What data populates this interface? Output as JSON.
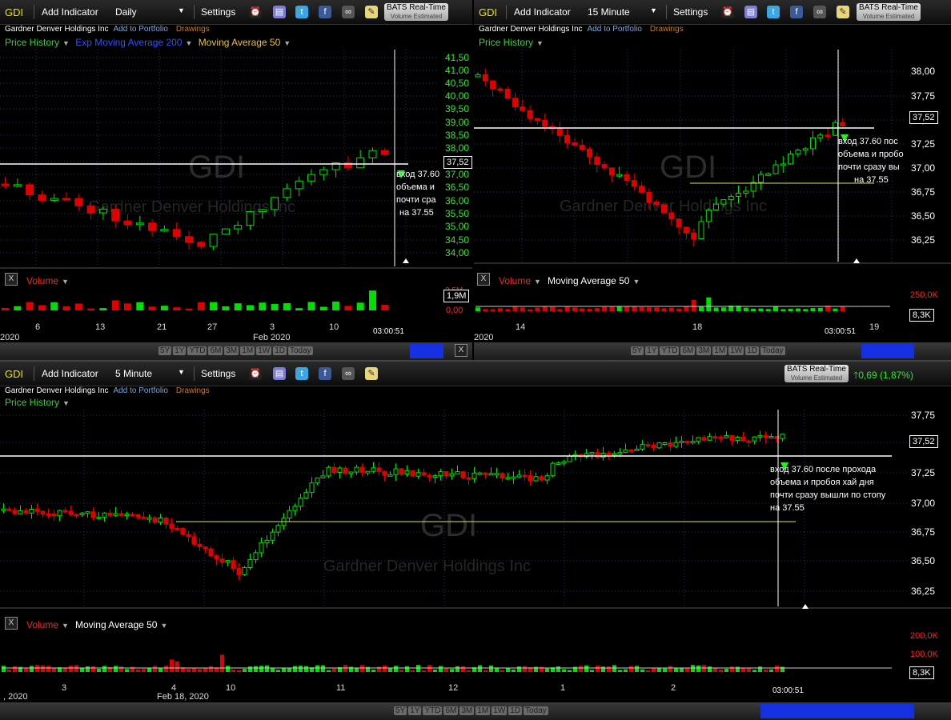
{
  "toolbar": {
    "add_indicator": "Add Indicator",
    "settings": "Settings",
    "bats": "BATS Real-Time",
    "volume_estimated": "Volume Estimated",
    "close": "X",
    "icons": [
      "alarm-clock-icon",
      "database-icon",
      "twitter-icon",
      "facebook-icon",
      "binoculars-icon",
      "notes-icon"
    ]
  },
  "company": {
    "symbol": "GDI",
    "name": "Gardner Denver Holdings Inc",
    "add_to_portfolio": "Add to Portfolio",
    "drawings": "Drawings"
  },
  "colors": {
    "up": "#00e000",
    "down": "#e00000",
    "price_line": "#ffffff",
    "support": "#e0e060",
    "ema": "#2f4fff",
    "ma": "#e6c23a"
  },
  "panel_daily": {
    "interval": "Daily",
    "price_history": "Price History",
    "ema_label": "Exp Moving Average 200",
    "ma_label": "Moving Average 50",
    "volume_label": "Volume",
    "watermark": "GDI",
    "price_tag": "37,52",
    "vol_tag": "1,9M",
    "vol_axis_top": "2,5M",
    "vol_axis_zero": "0,00",
    "price_ticks": [
      "41,50",
      "41,00",
      "40,50",
      "40,00",
      "39,50",
      "39,00",
      "38,50",
      "38,00",
      "37,50",
      "37,00",
      "36,50",
      "36,00",
      "35,50",
      "35,00",
      "34,50",
      "34,00"
    ],
    "date_ticks": [
      "6",
      "13",
      "21",
      "27",
      "3",
      "10"
    ],
    "date_start": "2020",
    "date_month": "Feb 2020",
    "time": "03:00:51",
    "annotation": [
      "вход 37.60",
      "объема и",
      "почти сра",
      "на 37.55"
    ],
    "ranges": [
      "5Y",
      "1Y",
      "YTD",
      "6M",
      "3M",
      "1M",
      "1W",
      "1D",
      "Today"
    ]
  },
  "panel_15m": {
    "interval": "15 Minute",
    "price_history": "Price History",
    "volume_label": "Volume",
    "ma_label": "Moving Average 50",
    "watermark": "GDI",
    "price_tag": "37,52",
    "vol_tag": "8,3K",
    "vol_axis_top": "250,0K",
    "price_ticks": [
      "38,00",
      "37,75",
      "37,50",
      "37,25",
      "37,00",
      "36,75",
      "36,50",
      "36,25"
    ],
    "date_ticks": [
      "14",
      "18",
      "19"
    ],
    "date_start": "2020",
    "time": "03:00:51",
    "annotation": [
      "вход 37.60 пос",
      "объема и пробо",
      "почти сразу вы",
      "на 37.55"
    ],
    "ranges": [
      "5Y",
      "1Y",
      "YTD",
      "6M",
      "3M",
      "1M",
      "1W",
      "1D",
      "Today"
    ]
  },
  "panel_5m": {
    "interval": "5 Minute",
    "price_history": "Price History",
    "volume_label": "Volume",
    "ma_label": "Moving Average 50",
    "watermark": "GDI",
    "change": "0,69 (1,87%)",
    "price_tag": "37,52",
    "vol_tag": "8,3K",
    "vol_axis": [
      "200,0K",
      "100,0K"
    ],
    "price_ticks": [
      "37,75",
      "37,50",
      "37,25",
      "37,00",
      "36,75",
      "36,50",
      "36,25"
    ],
    "date_ticks": [
      "3",
      "4",
      "10",
      "11",
      "12",
      "1",
      "2"
    ],
    "date_start": ", 2020",
    "date_month": "Feb 18, 2020",
    "time": "03:00:51",
    "annotation": [
      "вход 37.60 после прохода",
      "объема и пробоя хай дня",
      "почти сразу вышли по стопу",
      " на 37.55"
    ],
    "ranges": [
      "5Y",
      "1Y",
      "YTD",
      "6M",
      "3M",
      "1M",
      "1W",
      "1D",
      "Today"
    ]
  }
}
